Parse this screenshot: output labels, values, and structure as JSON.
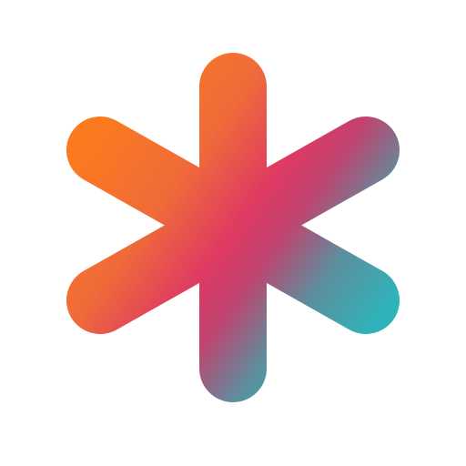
{
  "logo": {
    "icon": "asterisk-logo-icon",
    "background_color": "#ffffff",
    "gradient_stops": [
      "#fb7a1f",
      "#f06a3a",
      "#de3a62",
      "#c1426f",
      "#5c8f9e",
      "#2fb3ba"
    ]
  }
}
